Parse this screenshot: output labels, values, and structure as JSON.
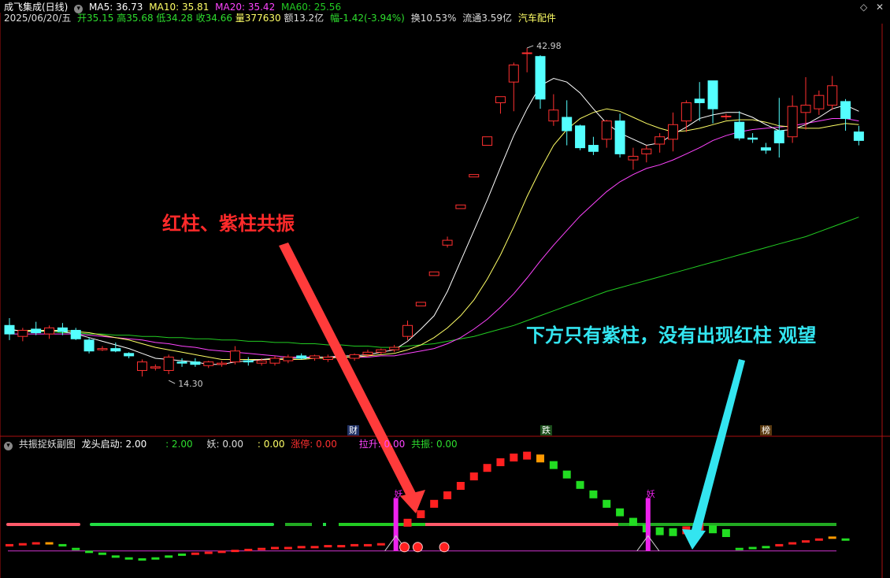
{
  "header": {
    "stock_name": "成飞集成(日线)",
    "ma5": "MA5: 36.73",
    "ma10": "MA10: 35.81",
    "ma20": "MA20: 35.42",
    "ma60": "MA60: 25.56",
    "date": "2025/06/20/五",
    "open": "开35.15",
    "high": "高35.68",
    "low": "低34.28",
    "close": "收34.66",
    "volume": "量377630",
    "amount": "额13.2亿",
    "change": "幅-1.42(-3.94%)",
    "turnover": "换10.53%",
    "float": "流通3.59亿",
    "sector": "汽车配件"
  },
  "colors": {
    "up": "#ff3030",
    "down": "#54ffff",
    "ma5": "#ffffff",
    "ma10": "#ffff66",
    "ma20": "#ff44ff",
    "ma60": "#22cc22",
    "panel_border": "#aa1111",
    "ann_red": "#ff2a2a",
    "ann_cyan": "#33e5f0"
  },
  "markers": {
    "cai": "财",
    "die": "跌",
    "bang": "榜"
  },
  "high_label": "42.98",
  "low_label": "14.30",
  "sub": {
    "title": "共振捉妖副图",
    "dragon": "龙头启动: 2.00",
    "v2": ": 2.00",
    "yao": "妖: 0.00",
    "v3": ": 0.00",
    "zt": "涨停: 0.00",
    "ls": "拉升: 0.00",
    "gz": "共振: 0.00",
    "yao_mark": "妖"
  },
  "annotations": {
    "left": "红柱、紫柱共振",
    "right": "下方只有紫柱，没有出现红柱 观望"
  },
  "chart_data": {
    "type": "candlestick",
    "ylim": [
      12,
      45
    ],
    "candles": [
      [
        20.2,
        20.8,
        19.0,
        19.5
      ],
      [
        19.3,
        20.0,
        18.9,
        19.8
      ],
      [
        19.9,
        20.5,
        19.4,
        19.6
      ],
      [
        19.5,
        20.2,
        19.1,
        20.0
      ],
      [
        20.0,
        20.4,
        19.4,
        19.7
      ],
      [
        19.8,
        20.0,
        19.0,
        19.1
      ],
      [
        19.0,
        19.2,
        17.9,
        18.1
      ],
      [
        18.2,
        18.5,
        18.1,
        18.3
      ],
      [
        18.3,
        18.8,
        18.0,
        18.1
      ],
      [
        17.9,
        18.0,
        17.5,
        17.7
      ],
      [
        16.5,
        17.4,
        16.0,
        17.2
      ],
      [
        16.7,
        17.0,
        16.5,
        16.8
      ],
      [
        16.5,
        17.8,
        16.2,
        17.6
      ],
      [
        17.2,
        17.5,
        16.8,
        17.1
      ],
      [
        17.2,
        17.5,
        16.8,
        17.0
      ],
      [
        16.9,
        17.3,
        16.7,
        17.2
      ],
      [
        17.0,
        17.3,
        16.8,
        17.1
      ],
      [
        17.2,
        18.5,
        17.0,
        18.1
      ],
      [
        17.3,
        17.6,
        16.9,
        17.2
      ],
      [
        17.1,
        17.5,
        16.9,
        17.3
      ],
      [
        17.1,
        17.7,
        16.9,
        17.5
      ],
      [
        17.3,
        17.8,
        17.1,
        17.6
      ],
      [
        17.7,
        17.9,
        17.4,
        17.5
      ],
      [
        17.5,
        17.8,
        17.3,
        17.7
      ],
      [
        17.4,
        17.8,
        17.2,
        17.6
      ],
      [
        17.6,
        17.8,
        17.4,
        17.7
      ],
      [
        17.5,
        17.9,
        17.3,
        17.8
      ],
      [
        17.8,
        18.2,
        17.6,
        18.0
      ],
      [
        18.0,
        18.3,
        17.8,
        18.2
      ],
      [
        18.2,
        18.6,
        18.0,
        18.4
      ],
      [
        19.3,
        20.6,
        19.0,
        20.2
      ],
      [
        21.8,
        22.1,
        21.8,
        22.1
      ],
      [
        24.3,
        24.6,
        24.3,
        24.6
      ],
      [
        26.8,
        27.5,
        26.6,
        27.2
      ],
      [
        29.8,
        30.1,
        29.8,
        30.1
      ],
      [
        32.4,
        32.6,
        32.4,
        32.6
      ],
      [
        35.0,
        35.7,
        35.0,
        35.7
      ],
      [
        38.5,
        39.0,
        37.6,
        39.0
      ],
      [
        40.2,
        41.8,
        37.8,
        41.6
      ],
      [
        42.6,
        43.0,
        41.0,
        42.6
      ],
      [
        42.3,
        42.4,
        38.0,
        38.8
      ],
      [
        37.0,
        39.2,
        36.6,
        37.9
      ],
      [
        37.3,
        38.7,
        35.0,
        36.2
      ],
      [
        36.6,
        36.7,
        34.6,
        34.8
      ],
      [
        35.0,
        35.7,
        34.2,
        34.5
      ],
      [
        35.5,
        37.1,
        34.8,
        37.0
      ],
      [
        37.0,
        37.6,
        34.0,
        34.3
      ],
      [
        33.8,
        34.8,
        33.0,
        34.1
      ],
      [
        34.3,
        35.0,
        33.6,
        34.7
      ],
      [
        35.1,
        36.0,
        34.4,
        35.7
      ],
      [
        35.5,
        37.7,
        34.5,
        36.7
      ],
      [
        37.0,
        38.7,
        36.1,
        38.5
      ],
      [
        38.8,
        40.2,
        37.0,
        38.5
      ],
      [
        40.3,
        40.3,
        36.8,
        38.0
      ],
      [
        37.4,
        37.6,
        37.1,
        37.4
      ],
      [
        36.9,
        37.8,
        35.4,
        35.6
      ],
      [
        35.6,
        36.0,
        35.2,
        35.5
      ],
      [
        34.8,
        35.2,
        34.3,
        34.6
      ],
      [
        36.2,
        38.9,
        34.0,
        35.2
      ],
      [
        35.7,
        39.1,
        35.2,
        38.2
      ],
      [
        37.7,
        40.6,
        36.3,
        38.3
      ],
      [
        38.0,
        39.5,
        37.5,
        39.1
      ],
      [
        38.3,
        40.7,
        37.9,
        39.9
      ],
      [
        38.6,
        38.8,
        36.2,
        37.2
      ],
      [
        36.1,
        36.6,
        35.0,
        35.4
      ]
    ],
    "ma5": [
      19.9,
      19.7,
      19.7,
      19.8,
      19.7,
      19.5,
      19.2,
      18.9,
      18.6,
      18.3,
      17.9,
      17.5,
      17.4,
      17.3,
      17.2,
      17.0,
      17.0,
      17.2,
      17.3,
      17.4,
      17.5,
      17.5,
      17.5,
      17.6,
      17.6,
      17.7,
      17.7,
      17.8,
      18.0,
      18.2,
      18.9,
      19.9,
      21.0,
      23.0,
      25.5,
      28.0,
      30.5,
      33.2,
      35.8,
      38.0,
      39.9,
      40.5,
      40.2,
      39.3,
      38.0,
      36.8,
      36.0,
      35.5,
      35.0,
      35.2,
      35.9,
      36.5,
      37.2,
      37.5,
      37.7,
      37.7,
      37.3,
      36.7,
      36.2,
      36.3,
      36.7,
      37.3,
      38.0,
      38.3,
      37.8
    ],
    "ma10": [
      19.8,
      19.8,
      19.8,
      19.8,
      19.8,
      19.7,
      19.6,
      19.4,
      19.2,
      19.0,
      18.7,
      18.4,
      18.2,
      18.0,
      17.8,
      17.6,
      17.4,
      17.4,
      17.4,
      17.4,
      17.4,
      17.4,
      17.4,
      17.5,
      17.5,
      17.6,
      17.6,
      17.7,
      17.8,
      17.9,
      18.2,
      18.6,
      19.2,
      20.0,
      21.0,
      22.3,
      24.0,
      26.0,
      28.3,
      30.8,
      33.0,
      35.0,
      36.3,
      37.2,
      37.7,
      38.0,
      37.8,
      37.3,
      36.8,
      36.4,
      36.1,
      36.2,
      36.4,
      36.7,
      37.0,
      37.1,
      37.1,
      36.9,
      36.6,
      36.5,
      36.4,
      36.4,
      36.6,
      36.8,
      36.7
    ],
    "ma20": [
      19.5,
      19.5,
      19.5,
      19.5,
      19.5,
      19.5,
      19.4,
      19.3,
      19.2,
      19.1,
      19.0,
      18.8,
      18.7,
      18.5,
      18.4,
      18.2,
      18.1,
      18.0,
      17.9,
      17.8,
      17.7,
      17.6,
      17.6,
      17.6,
      17.6,
      17.6,
      17.6,
      17.6,
      17.7,
      17.7,
      17.9,
      18.1,
      18.3,
      18.7,
      19.2,
      19.9,
      20.7,
      21.7,
      22.8,
      24.1,
      25.5,
      26.8,
      28.0,
      29.2,
      30.2,
      31.2,
      32.0,
      32.6,
      33.1,
      33.4,
      33.8,
      34.3,
      34.8,
      35.4,
      35.8,
      36.1,
      36.3,
      36.4,
      36.5,
      36.6,
      36.8,
      37.0,
      37.2,
      37.2,
      37.0
    ],
    "ma60": [
      19.8,
      19.8,
      19.7,
      19.7,
      19.6,
      19.6,
      19.5,
      19.5,
      19.4,
      19.4,
      19.3,
      19.3,
      19.2,
      19.2,
      19.1,
      19.1,
      19.0,
      19.0,
      18.9,
      18.9,
      18.8,
      18.8,
      18.7,
      18.7,
      18.6,
      18.6,
      18.5,
      18.5,
      18.4,
      18.4,
      18.5,
      18.6,
      18.7,
      18.9,
      19.1,
      19.3,
      19.6,
      19.9,
      20.2,
      20.6,
      21.0,
      21.4,
      21.8,
      22.2,
      22.6,
      23.0,
      23.3,
      23.6,
      23.9,
      24.2,
      24.5,
      24.8,
      25.1,
      25.4,
      25.7,
      26.0,
      26.3,
      26.6,
      26.9,
      27.2,
      27.5,
      27.9,
      28.3,
      28.7,
      29.1
    ],
    "sub_bars": [
      {
        "i": 30,
        "v": 0.1,
        "c": "#ff2020"
      },
      {
        "i": 31,
        "v": 1.0,
        "c": "#ff2020"
      },
      {
        "i": 32,
        "v": 2.1,
        "c": "#ff2020"
      },
      {
        "i": 33,
        "v": 3.0,
        "c": "#ff2020"
      },
      {
        "i": 34,
        "v": 4.0,
        "c": "#ff2020"
      },
      {
        "i": 35,
        "v": 5.0,
        "c": "#ff2020"
      },
      {
        "i": 36,
        "v": 5.9,
        "c": "#ff2020"
      },
      {
        "i": 37,
        "v": 6.5,
        "c": "#ff2020"
      },
      {
        "i": 38,
        "v": 7.0,
        "c": "#ff2020"
      },
      {
        "i": 39,
        "v": 7.2,
        "c": "#ff2020"
      },
      {
        "i": 40,
        "v": 6.9,
        "c": "#ff9900"
      },
      {
        "i": 41,
        "v": 6.2,
        "c": "#22dd22"
      },
      {
        "i": 42,
        "v": 5.2,
        "c": "#22dd22"
      },
      {
        "i": 43,
        "v": 4.1,
        "c": "#22dd22"
      },
      {
        "i": 44,
        "v": 3.1,
        "c": "#22dd22"
      },
      {
        "i": 45,
        "v": 2.1,
        "c": "#22dd22"
      },
      {
        "i": 46,
        "v": 1.2,
        "c": "#22dd22"
      },
      {
        "i": 47,
        "v": 0.2,
        "c": "#22dd22"
      },
      {
        "i": 48,
        "v": -0.5,
        "c": "#22dd22"
      },
      {
        "i": 49,
        "v": -0.8,
        "c": "#22dd22"
      },
      {
        "i": 50,
        "v": -0.9,
        "c": "#22dd22"
      },
      {
        "i": 51,
        "v": -0.7,
        "c": "#ff2020"
      },
      {
        "i": 52,
        "v": -0.3,
        "c": "#ff2020"
      },
      {
        "i": 53,
        "v": -0.6,
        "c": "#22dd22"
      },
      {
        "i": 54,
        "v": -1.0,
        "c": "#22dd22"
      }
    ],
    "sub_small": [
      {
        "i": 0,
        "v": -2.2,
        "c": "#ff2020"
      },
      {
        "i": 1,
        "v": -2.1,
        "c": "#ff2020"
      },
      {
        "i": 2,
        "v": -2.0,
        "c": "#ff2020"
      },
      {
        "i": 3,
        "v": -2.0,
        "c": "#ff9900"
      },
      {
        "i": 4,
        "v": -2.2,
        "c": "#22dd22"
      },
      {
        "i": 5,
        "v": -2.6,
        "c": "#22dd22"
      },
      {
        "i": 6,
        "v": -2.9,
        "c": "#22dd22"
      },
      {
        "i": 7,
        "v": -3.1,
        "c": "#22dd22"
      },
      {
        "i": 8,
        "v": -3.4,
        "c": "#22dd22"
      },
      {
        "i": 9,
        "v": -3.6,
        "c": "#22dd22"
      },
      {
        "i": 10,
        "v": -3.7,
        "c": "#22dd22"
      },
      {
        "i": 11,
        "v": -3.6,
        "c": "#22dd22"
      },
      {
        "i": 12,
        "v": -3.4,
        "c": "#22dd22"
      },
      {
        "i": 13,
        "v": -3.2,
        "c": "#22dd22"
      },
      {
        "i": 14,
        "v": -3.1,
        "c": "#ff2020"
      },
      {
        "i": 15,
        "v": -3.0,
        "c": "#ff2020"
      },
      {
        "i": 16,
        "v": -2.9,
        "c": "#ff2020"
      },
      {
        "i": 17,
        "v": -2.8,
        "c": "#ff2020"
      },
      {
        "i": 18,
        "v": -2.7,
        "c": "#ff2020"
      },
      {
        "i": 19,
        "v": -2.6,
        "c": "#ff2020"
      },
      {
        "i": 20,
        "v": -2.5,
        "c": "#ff2020"
      },
      {
        "i": 21,
        "v": -2.5,
        "c": "#ff2020"
      },
      {
        "i": 22,
        "v": -2.4,
        "c": "#ff2020"
      },
      {
        "i": 23,
        "v": -2.4,
        "c": "#ff2020"
      },
      {
        "i": 24,
        "v": -2.3,
        "c": "#ff2020"
      },
      {
        "i": 25,
        "v": -2.3,
        "c": "#ff2020"
      },
      {
        "i": 26,
        "v": -2.2,
        "c": "#ff2020"
      },
      {
        "i": 27,
        "v": -2.2,
        "c": "#ff2020"
      },
      {
        "i": 28,
        "v": -2.1,
        "c": "#ff2020"
      },
      {
        "i": 55,
        "v": -2.6,
        "c": "#22dd22"
      },
      {
        "i": 56,
        "v": -2.5,
        "c": "#22dd22"
      },
      {
        "i": 57,
        "v": -2.4,
        "c": "#22dd22"
      },
      {
        "i": 58,
        "v": -2.2,
        "c": "#ff2020"
      },
      {
        "i": 59,
        "v": -2.0,
        "c": "#ff2020"
      },
      {
        "i": 60,
        "v": -1.8,
        "c": "#ff2020"
      },
      {
        "i": 61,
        "v": -1.6,
        "c": "#ff2020"
      },
      {
        "i": 62,
        "v": -1.4,
        "c": "#ff9900"
      },
      {
        "i": 63,
        "v": -1.6,
        "c": "#22dd22"
      }
    ],
    "purple_bars": [
      29,
      48
    ],
    "sub_ylim": [
      -4.5,
      8
    ]
  }
}
